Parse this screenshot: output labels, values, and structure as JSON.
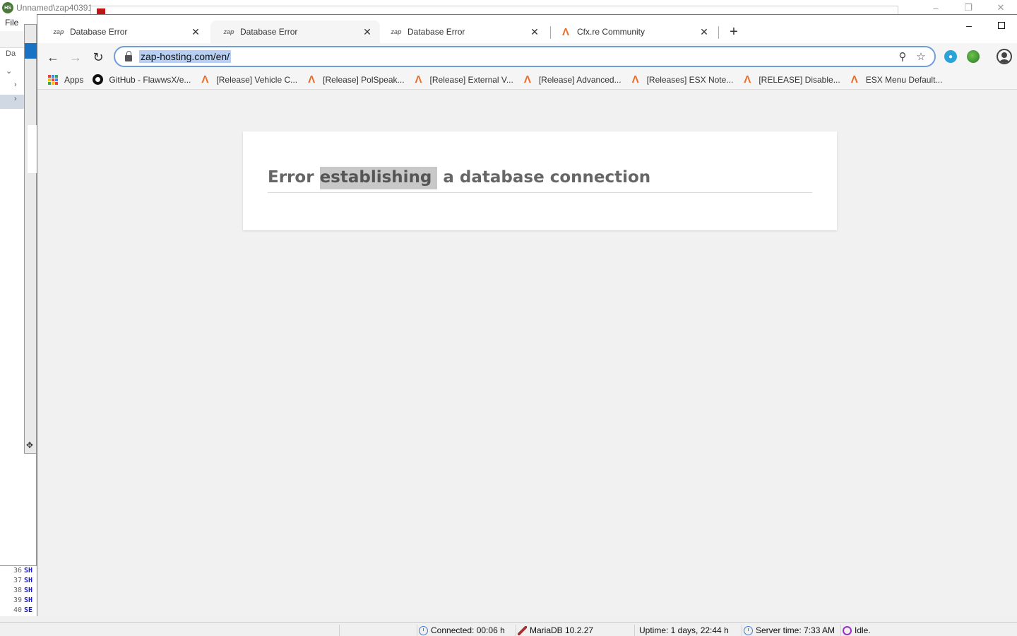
{
  "background_app": {
    "title": "Unnamed\\zap40391",
    "menu_file": "File",
    "tree_label": "Da",
    "query_lines": [
      {
        "num": "36",
        "text": "SH"
      },
      {
        "num": "37",
        "text": "SH"
      },
      {
        "num": "38",
        "text": "SH"
      },
      {
        "num": "39",
        "text": "SH"
      },
      {
        "num": "40",
        "text": "SE"
      }
    ],
    "status": {
      "connected": "Connected: 00:06 h",
      "server": "MariaDB 10.2.27",
      "uptime": "Uptime: 1 days, 22:44 h",
      "server_time": "Server time: 7:33 AM",
      "state": "Idle."
    }
  },
  "browser": {
    "tabs": [
      {
        "label": "Database Error",
        "favicon": "zap-icon",
        "active": false
      },
      {
        "label": "Database Error",
        "favicon": "zap-icon",
        "active": true
      },
      {
        "label": "Database Error",
        "favicon": "zap-icon",
        "active": false
      },
      {
        "label": "Cfx.re Community",
        "favicon": "cfx-icon",
        "active": false
      }
    ],
    "favicon_zap": "zap",
    "favicon_cfx": "Λ",
    "url": "zap-hosting.com/en/",
    "bookmarks": [
      {
        "label": "Apps",
        "icon": "apps-grid-icon"
      },
      {
        "label": "GitHub - FlawwsX/e...",
        "icon": "github-icon"
      },
      {
        "label": "[Release] Vehicle C...",
        "icon": "cfx-icon"
      },
      {
        "label": "[Release] PolSpeak...",
        "icon": "cfx-icon"
      },
      {
        "label": "[Release] External V...",
        "icon": "cfx-icon"
      },
      {
        "label": "[Release] Advanced...",
        "icon": "cfx-icon"
      },
      {
        "label": "[Releases] ESX Note...",
        "icon": "cfx-icon"
      },
      {
        "label": "[RELEASE] Disable...",
        "icon": "cfx-icon"
      },
      {
        "label": "ESX Menu Default...",
        "icon": "cfx-icon"
      }
    ],
    "page": {
      "heading_before": "Error ",
      "heading_highlight": "establishing",
      "heading_after": " a database connection"
    }
  },
  "colors": {
    "omnibox_border": "#6e9ddb",
    "url_selection": "#b6cff2",
    "cfx_orange": "#ee6b28",
    "heading_gray": "#666666"
  }
}
